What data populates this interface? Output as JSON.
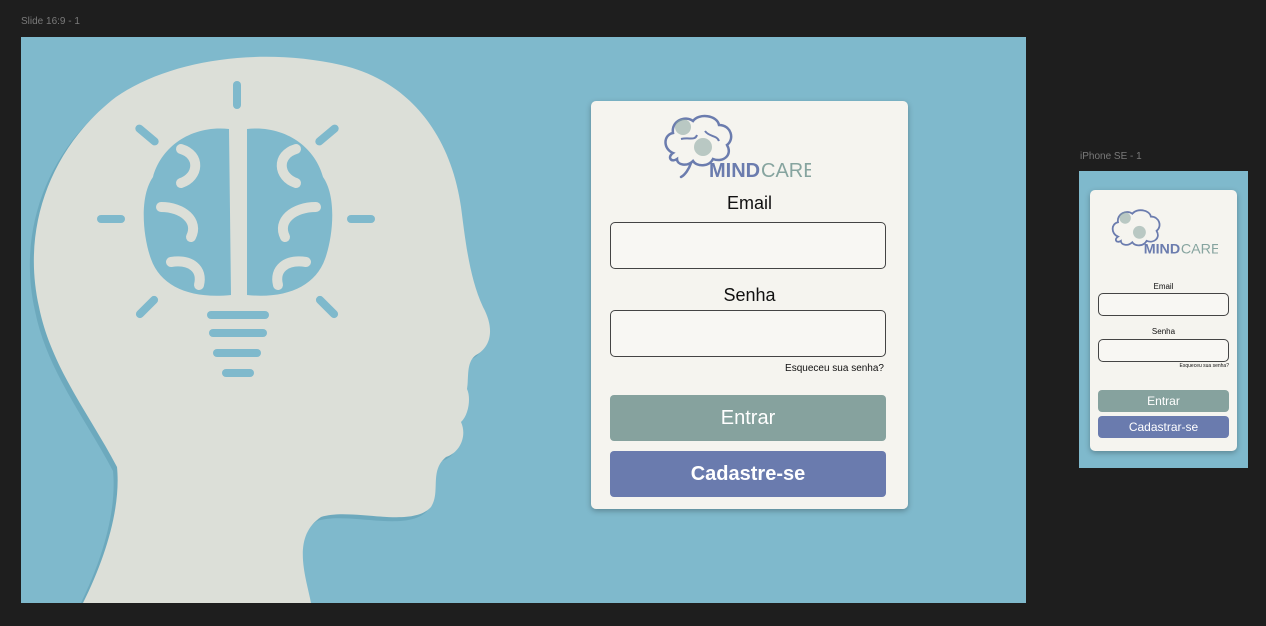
{
  "frames": {
    "desktop_label": "Slide 16:9 - 1",
    "phone_label": "iPhone SE - 1"
  },
  "logo": {
    "part1": "MIND",
    "part2": "CARE"
  },
  "form": {
    "email_label": "Email",
    "email_value": "",
    "password_label": "Senha",
    "password_value": "",
    "forgot_link": "Esqueceu sua senha?",
    "enter_button": "Entrar",
    "signup_button": "Cadastre-se"
  },
  "mobile_form": {
    "email_label": "Email",
    "password_label": "Senha",
    "forgot_link": "Esqueceu sua senha?",
    "enter_button": "Entrar",
    "signup_button": "Cadastrar-se"
  },
  "colors": {
    "background": "#7fb9cc",
    "card": "#f5f4ef",
    "enter": "#86a29e",
    "signup": "#6a7bae",
    "brand_mind": "#6b7cae",
    "brand_care": "#86a49f"
  }
}
